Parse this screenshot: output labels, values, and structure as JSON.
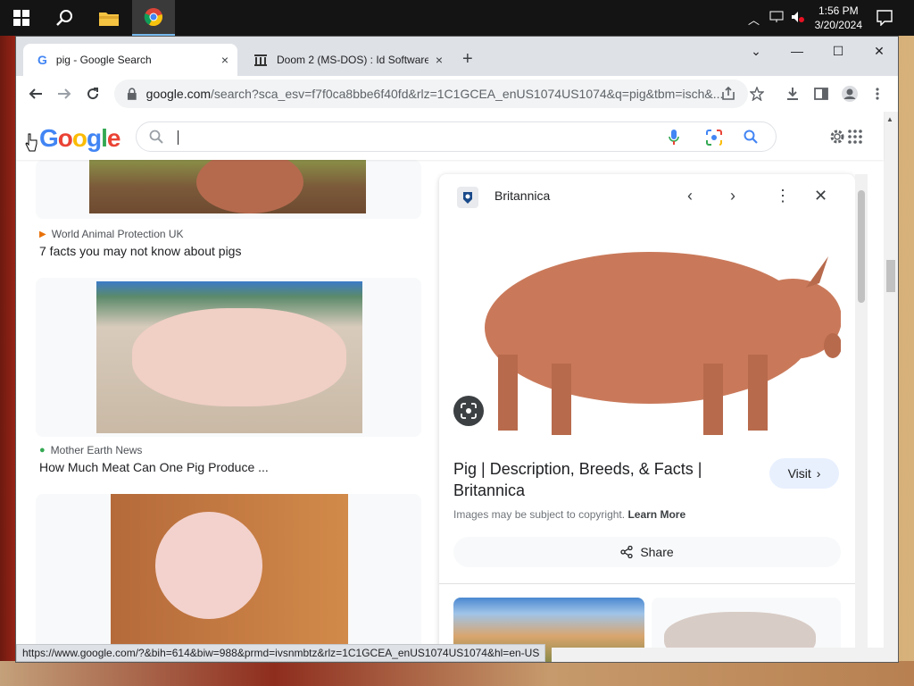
{
  "taskbar": {
    "clock_time": "1:56 PM",
    "clock_date": "3/20/2024"
  },
  "tabs": [
    {
      "title": "pig - Google Search",
      "close": "×"
    },
    {
      "title": "Doom 2 (MS-DOS) : Id Software :",
      "close": "×"
    }
  ],
  "new_tab_label": "+",
  "window_controls": {
    "minimize": "—",
    "maximize": "☐",
    "close": "✕",
    "tab_search": "⌄"
  },
  "toolbar": {
    "url_host": "google.com",
    "url_rest": "/search?sca_esv=f7f0ca8bbe6f40fd&rlz=1C1GCEA_enUS1074US1074&q=pig&tbm=isch&..."
  },
  "google": {
    "logo": "Google",
    "search_value": ""
  },
  "results": [
    {
      "source": "World Animal Protection UK",
      "title": "7 facts you may not know about pigs"
    },
    {
      "source": "Mother Earth News",
      "title": "How Much Meat Can One Pig Produce ..."
    }
  ],
  "side_panel": {
    "source": "Britannica",
    "title": "Pig | Description, Breeds, & Facts | Britannica",
    "visit_label": "Visit",
    "copyright_text": "Images may be subject to copyright.",
    "learn_more": "Learn More",
    "share_label": "Share"
  },
  "status_url": "https://www.google.com/?&bih=614&biw=988&prmd=ivsnmbtz&rlz=1C1GCEA_enUS1074US1074&hl=en-US",
  "colors": {
    "google_blue": "#4285F4",
    "google_red": "#EA4335",
    "google_yellow": "#FBBC05",
    "google_green": "#34A853",
    "pig_pink": "#c9795a"
  }
}
